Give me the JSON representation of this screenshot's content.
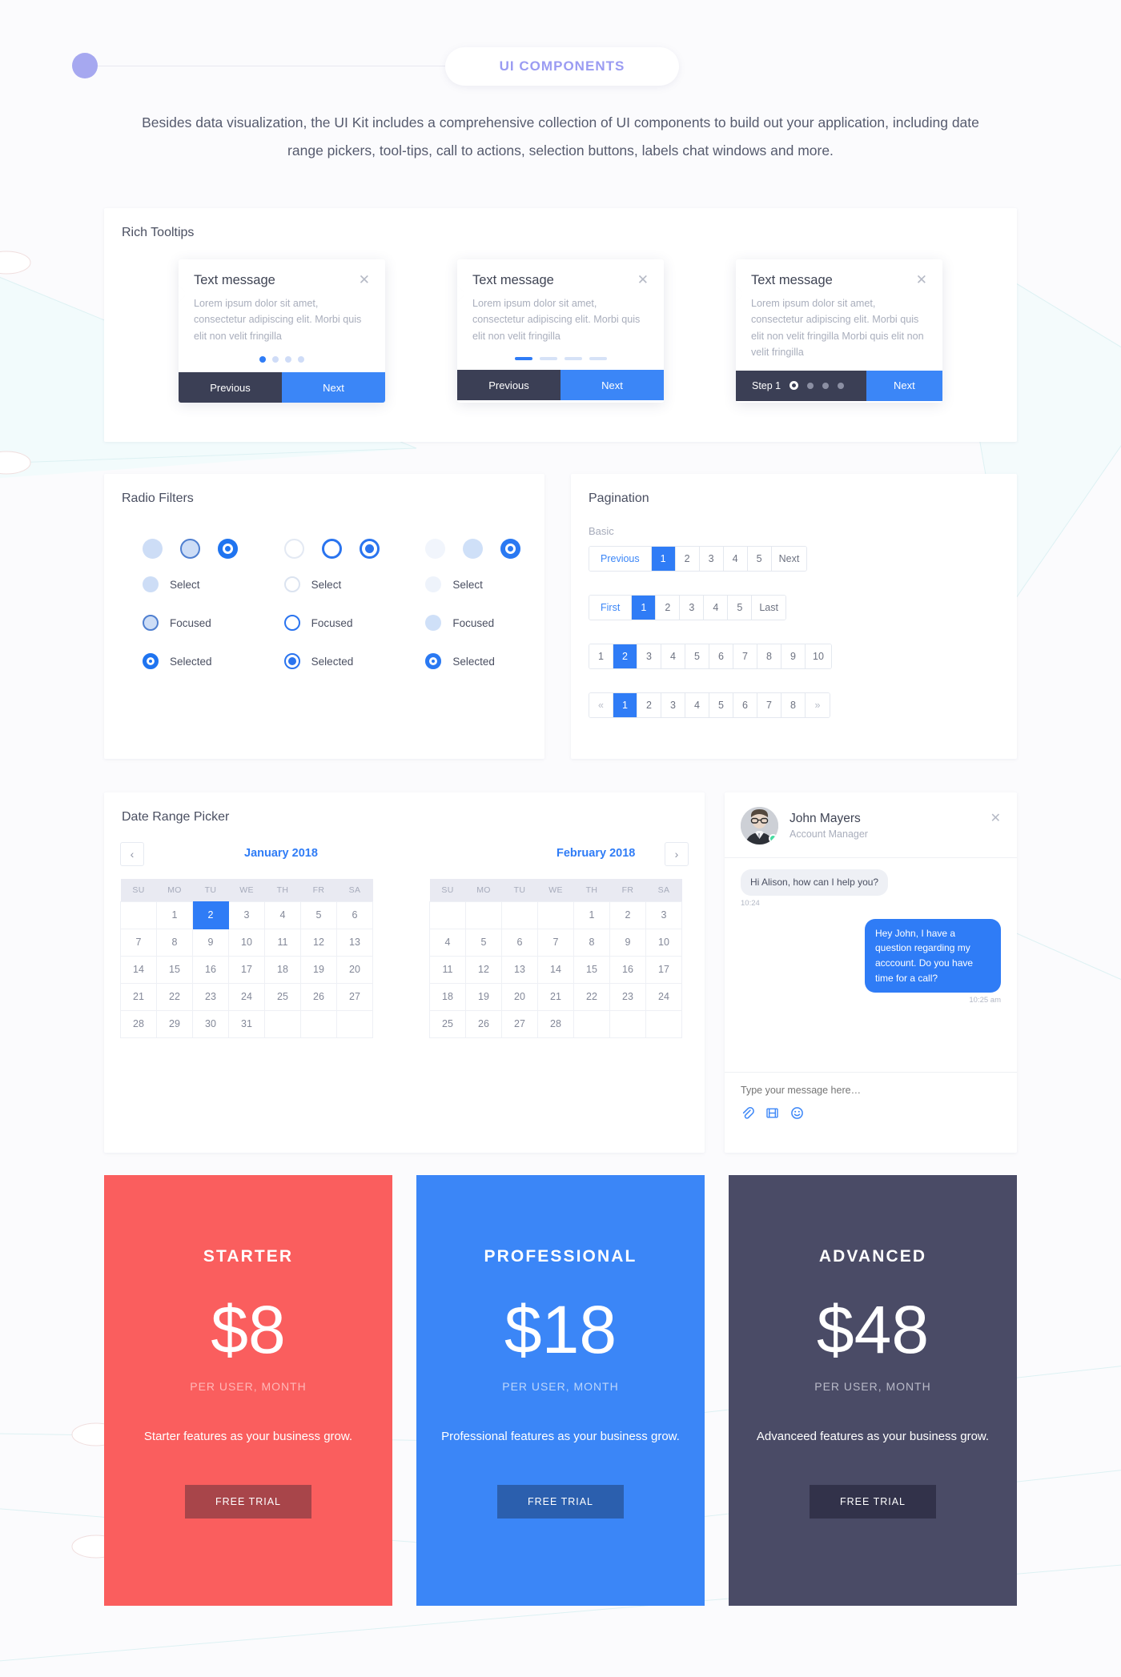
{
  "header": {
    "badge": "UI COMPONENTS",
    "intro_line1": "Besides data visualization, the UI Kit includes a comprehensive collection of UI components to build out your application, including",
    "intro_line2": "date range pickers, tool-tips, call to actions, selection buttons, labels chat windows and more."
  },
  "tooltips": {
    "section_title": "Rich Tooltips",
    "items": [
      {
        "title": "Text message",
        "body": "Lorem ipsum dolor sit amet, consectetur adipiscing elit. Morbi quis elit non velit fringilla",
        "indicator": "dots",
        "dots_total": 4,
        "dots_active": 1,
        "prev_label": "Previous",
        "next_label": "Next"
      },
      {
        "title": "Text message",
        "body": "Lorem ipsum dolor sit amet, consectetur adipiscing elit. Morbi quis elit non velit fringilla",
        "indicator": "bars",
        "dots_total": 4,
        "dots_active": 1,
        "prev_label": "Previous",
        "next_label": "Next"
      },
      {
        "title": "Text message",
        "body": "Lorem ipsum dolor sit amet, consectetur adipiscing elit. Morbi quis elit non velit fringilla Morbi quis elit non velit fringilla",
        "indicator": "step",
        "dots_total": 4,
        "dots_active": 1,
        "step_label": "Step 1",
        "next_label": "Next"
      }
    ]
  },
  "radio_filters": {
    "section_title": "Radio Filters",
    "state_labels": [
      "Select",
      "Focused",
      "Selected"
    ],
    "columns": [
      "filled",
      "outline",
      "soft"
    ]
  },
  "pagination": {
    "section_title": "Pagination",
    "subtitle": "Basic",
    "groups": [
      {
        "name": "previous-next",
        "cells": [
          {
            "label": "Previous",
            "style": "accent"
          },
          {
            "label": "1",
            "style": "active"
          },
          {
            "label": "2",
            "style": "plain"
          },
          {
            "label": "3",
            "style": "plain"
          },
          {
            "label": "4",
            "style": "plain"
          },
          {
            "label": "5",
            "style": "plain"
          },
          {
            "label": "Next",
            "style": "plain"
          }
        ]
      },
      {
        "name": "first-last",
        "cells": [
          {
            "label": "First",
            "style": "accent"
          },
          {
            "label": "1",
            "style": "active"
          },
          {
            "label": "2",
            "style": "plain"
          },
          {
            "label": "3",
            "style": "plain"
          },
          {
            "label": "4",
            "style": "plain"
          },
          {
            "label": "5",
            "style": "plain"
          },
          {
            "label": "Last",
            "style": "plain"
          }
        ]
      },
      {
        "name": "numbers-ten",
        "cells": [
          {
            "label": "1",
            "style": "plain"
          },
          {
            "label": "2",
            "style": "active"
          },
          {
            "label": "3",
            "style": "plain"
          },
          {
            "label": "4",
            "style": "plain"
          },
          {
            "label": "5",
            "style": "plain"
          },
          {
            "label": "6",
            "style": "plain"
          },
          {
            "label": "7",
            "style": "plain"
          },
          {
            "label": "8",
            "style": "plain"
          },
          {
            "label": "9",
            "style": "plain"
          },
          {
            "label": "10",
            "style": "plain"
          }
        ]
      },
      {
        "name": "chevrons",
        "cells": [
          {
            "label": "«",
            "style": "muted"
          },
          {
            "label": "1",
            "style": "active"
          },
          {
            "label": "2",
            "style": "plain"
          },
          {
            "label": "3",
            "style": "plain"
          },
          {
            "label": "4",
            "style": "plain"
          },
          {
            "label": "5",
            "style": "plain"
          },
          {
            "label": "6",
            "style": "plain"
          },
          {
            "label": "7",
            "style": "plain"
          },
          {
            "label": "8",
            "style": "plain"
          },
          {
            "label": "»",
            "style": "muted"
          }
        ]
      }
    ]
  },
  "date_picker": {
    "section_title": "Date Range Picker",
    "prev_icon": "chevron-left-icon",
    "next_icon": "chevron-right-icon",
    "weekdays": [
      "SU",
      "MO",
      "TU",
      "WE",
      "TH",
      "FR",
      "SA"
    ],
    "months": [
      {
        "label": "January 2018",
        "lead_blanks": 1,
        "days": 31,
        "selected": 2
      },
      {
        "label": "February 2018",
        "lead_blanks": 4,
        "days": 28,
        "selected": null
      }
    ]
  },
  "chat": {
    "name": "John Mayers",
    "role": "Account Manager",
    "status": "online",
    "close_icon": "close-icon",
    "messages": [
      {
        "side": "in",
        "text": "Hi Alison, how can I help you?",
        "time": "10:24"
      },
      {
        "side": "out",
        "text": "Hey John, I have a question regarding my acccount. Do you have time for a call?",
        "time": "10:25 am"
      }
    ],
    "input_placeholder": "Type your message here…",
    "icons": [
      "attachment-icon",
      "video-icon",
      "emoji-icon"
    ]
  },
  "pricing": {
    "cards": [
      {
        "name": "STARTER",
        "amount": "$8",
        "period": "PER USER, MONTH",
        "desc": "Starter features as your business grow.",
        "cta": "FREE TRIAL",
        "bg": "#fa5e5e",
        "btn_bg": "#a8454a",
        "per_color": "#ffb8b8"
      },
      {
        "name": "PROFESSIONAL",
        "amount": "$18",
        "period": "PER USER, MONTH",
        "desc": "Professional features as your business grow.",
        "cta": "FREE TRIAL",
        "bg": "#3b86f7",
        "btn_bg": "#2b5fae",
        "per_color": "#bcd6fb"
      },
      {
        "name": "ADVANCED",
        "amount": "$48",
        "period": "PER USER, MONTH",
        "desc": "Advanceed features as your business grow.",
        "cta": "FREE TRIAL",
        "bg": "#4a4b66",
        "btn_bg": "#32324a",
        "per_color": "#b9bac8"
      }
    ]
  }
}
